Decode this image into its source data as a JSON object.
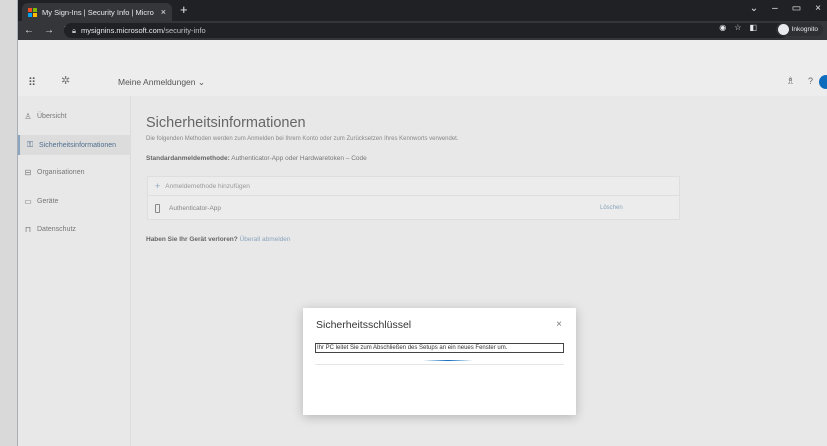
{
  "browser": {
    "tab_title": "My Sign-Ins | Security Info | Micro",
    "tab_close": "×",
    "new_tab": "+",
    "url_domain": "mysignins.microsoft.com",
    "url_path": "/security-info",
    "profile_label": "Inkognito",
    "window_controls": [
      "⌄",
      "–",
      "▭",
      "×"
    ]
  },
  "app": {
    "title": "Meine Anmeldungen",
    "title_chevron": "⌄"
  },
  "nav": {
    "items": [
      {
        "label": "Übersicht",
        "icon": "person-icon",
        "glyph": "♙",
        "active": false
      },
      {
        "label": "Sicherheitsinformationen",
        "icon": "key-icon",
        "glyph": "⚿",
        "active": true
      },
      {
        "label": "Organisationen",
        "icon": "briefcase-icon",
        "glyph": "⊟",
        "active": false
      },
      {
        "label": "Geräte",
        "icon": "laptop-icon",
        "glyph": "▭",
        "active": false
      },
      {
        "label": "Datenschutz",
        "icon": "lock-icon",
        "glyph": "⊓",
        "active": false
      }
    ]
  },
  "main": {
    "title": "Sicherheitsinformationen",
    "description": "Die folgenden Methoden werden zum Anmelden bei Ihrem Konto oder zum Zurücksetzen Ihres Kennworts verwendet.",
    "default_method_label": "Standardanmeldemethode:",
    "default_method_value": "Authenticator-App oder Hardwaretoken – Code",
    "add_method": "Anmeldemethode hinzufügen",
    "methods": [
      {
        "name": "Authenticator-App",
        "action": "Löschen"
      }
    ],
    "lost_device_question": "Haben Sie Ihr Gerät verloren?",
    "lost_device_link": "Überall abmelden"
  },
  "modal": {
    "title": "Sicherheitsschlüssel",
    "close": "×",
    "message": "Ihr PC leitet Sie zum Abschließen des Setups an ein neues Fenster um."
  },
  "colors": {
    "accent": "#0f6cbd",
    "chrome_dark": "#202124",
    "chrome_toolbar": "#35363a"
  }
}
